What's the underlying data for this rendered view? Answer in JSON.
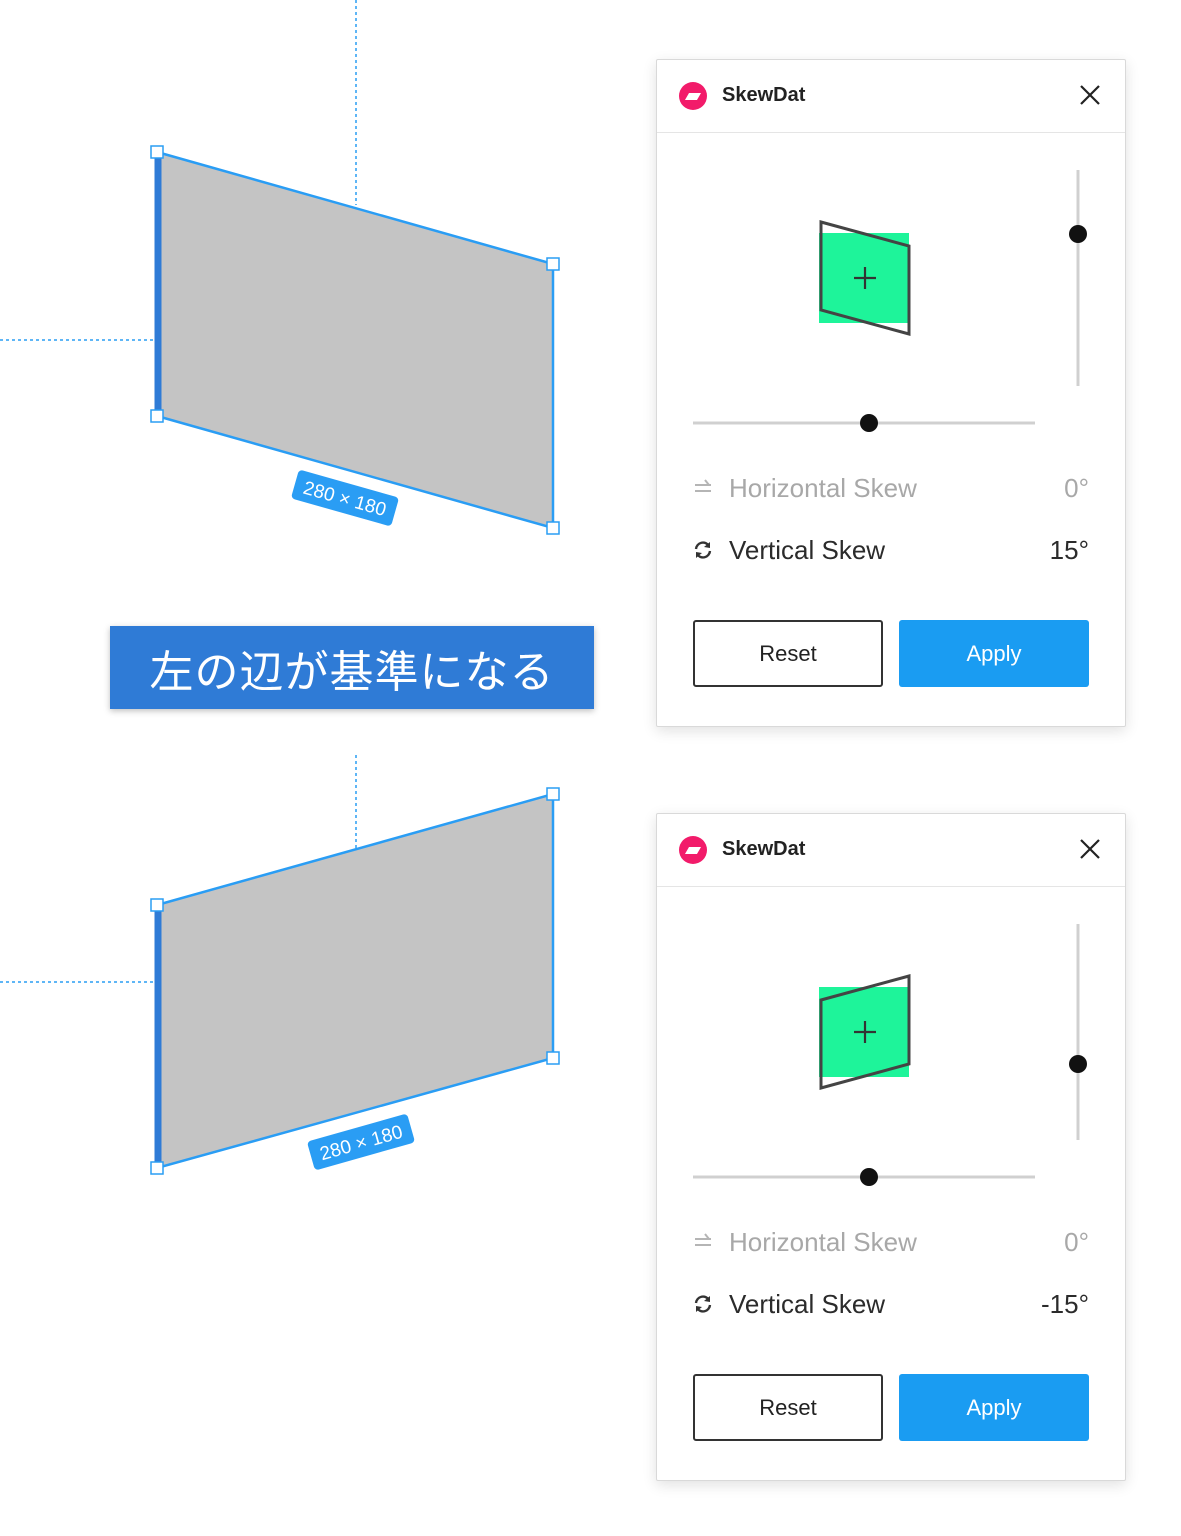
{
  "canvas": {
    "banner_text": "左の辺が基準になる",
    "dimension_label_top": "280 × 180",
    "dimension_label_bottom": "280 × 180"
  },
  "panels": [
    {
      "title": "SkewDat",
      "horizontal_label": "Horizontal Skew",
      "horizontal_value": "0°",
      "vertical_label": "Vertical Skew",
      "vertical_value": "15°",
      "reset_label": "Reset",
      "apply_label": "Apply"
    },
    {
      "title": "SkewDat",
      "horizontal_label": "Horizontal Skew",
      "horizontal_value": "0°",
      "vertical_label": "Vertical Skew",
      "vertical_value": "-15°",
      "reset_label": "Reset",
      "apply_label": "Apply"
    }
  ],
  "colors": {
    "selection": "#2a9df4",
    "shape_fill": "#c4c4c4",
    "preview_green": "#1ef49a",
    "apply": "#1a9cf2",
    "banner": "#2f7bd6",
    "logo": "#f21b6a"
  }
}
